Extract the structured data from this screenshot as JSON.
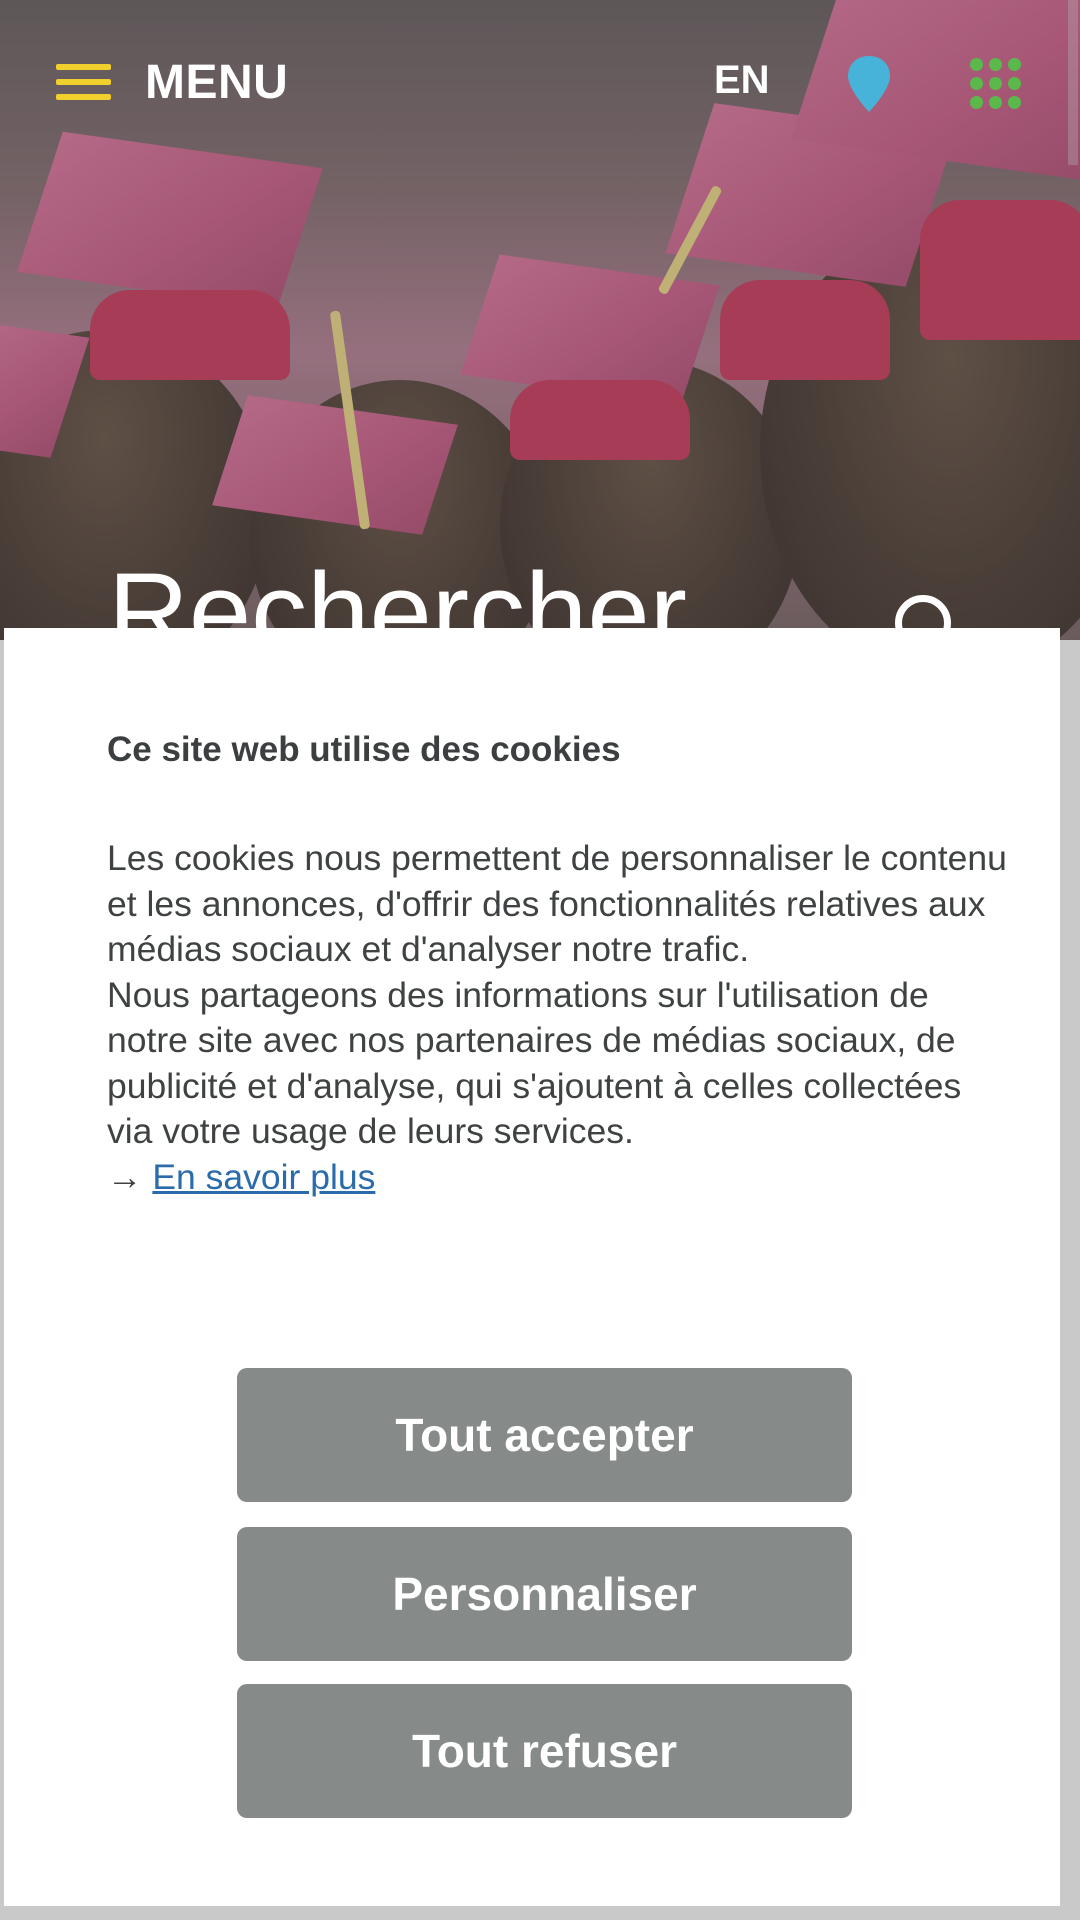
{
  "header": {
    "menu_label": "MENU",
    "language": "EN"
  },
  "icons": {
    "menu": "hamburger-icon",
    "location": "map-pin-icon",
    "apps": "apps-grid-icon",
    "search": "search-icon"
  },
  "colors": {
    "hamburger": "#f1cf2d",
    "location": "#48b3d9",
    "apps": "#5ab94a",
    "button": "#868a88",
    "link": "#2a6cab"
  },
  "hero": {
    "search_title": "Rechercher"
  },
  "cookie_banner": {
    "title": "Ce site web utilise des cookies",
    "paragraph_1": "Les cookies nous permettent de personnaliser le contenu et les annonces, d'offrir des fonctionnalités relatives aux médias sociaux et d'analyser notre trafic.",
    "paragraph_2": "Nous partageons des informations sur l'utilisation de notre site avec nos partenaires de médias sociaux, de publicité et d'analyse, qui s'ajoutent à celles collectées via votre usage de leurs services.",
    "arrow": "→",
    "learn_more": "En savoir plus",
    "buttons": {
      "accept_all": "Tout accepter",
      "customize": "Personnaliser",
      "refuse_all": "Tout refuser"
    }
  }
}
